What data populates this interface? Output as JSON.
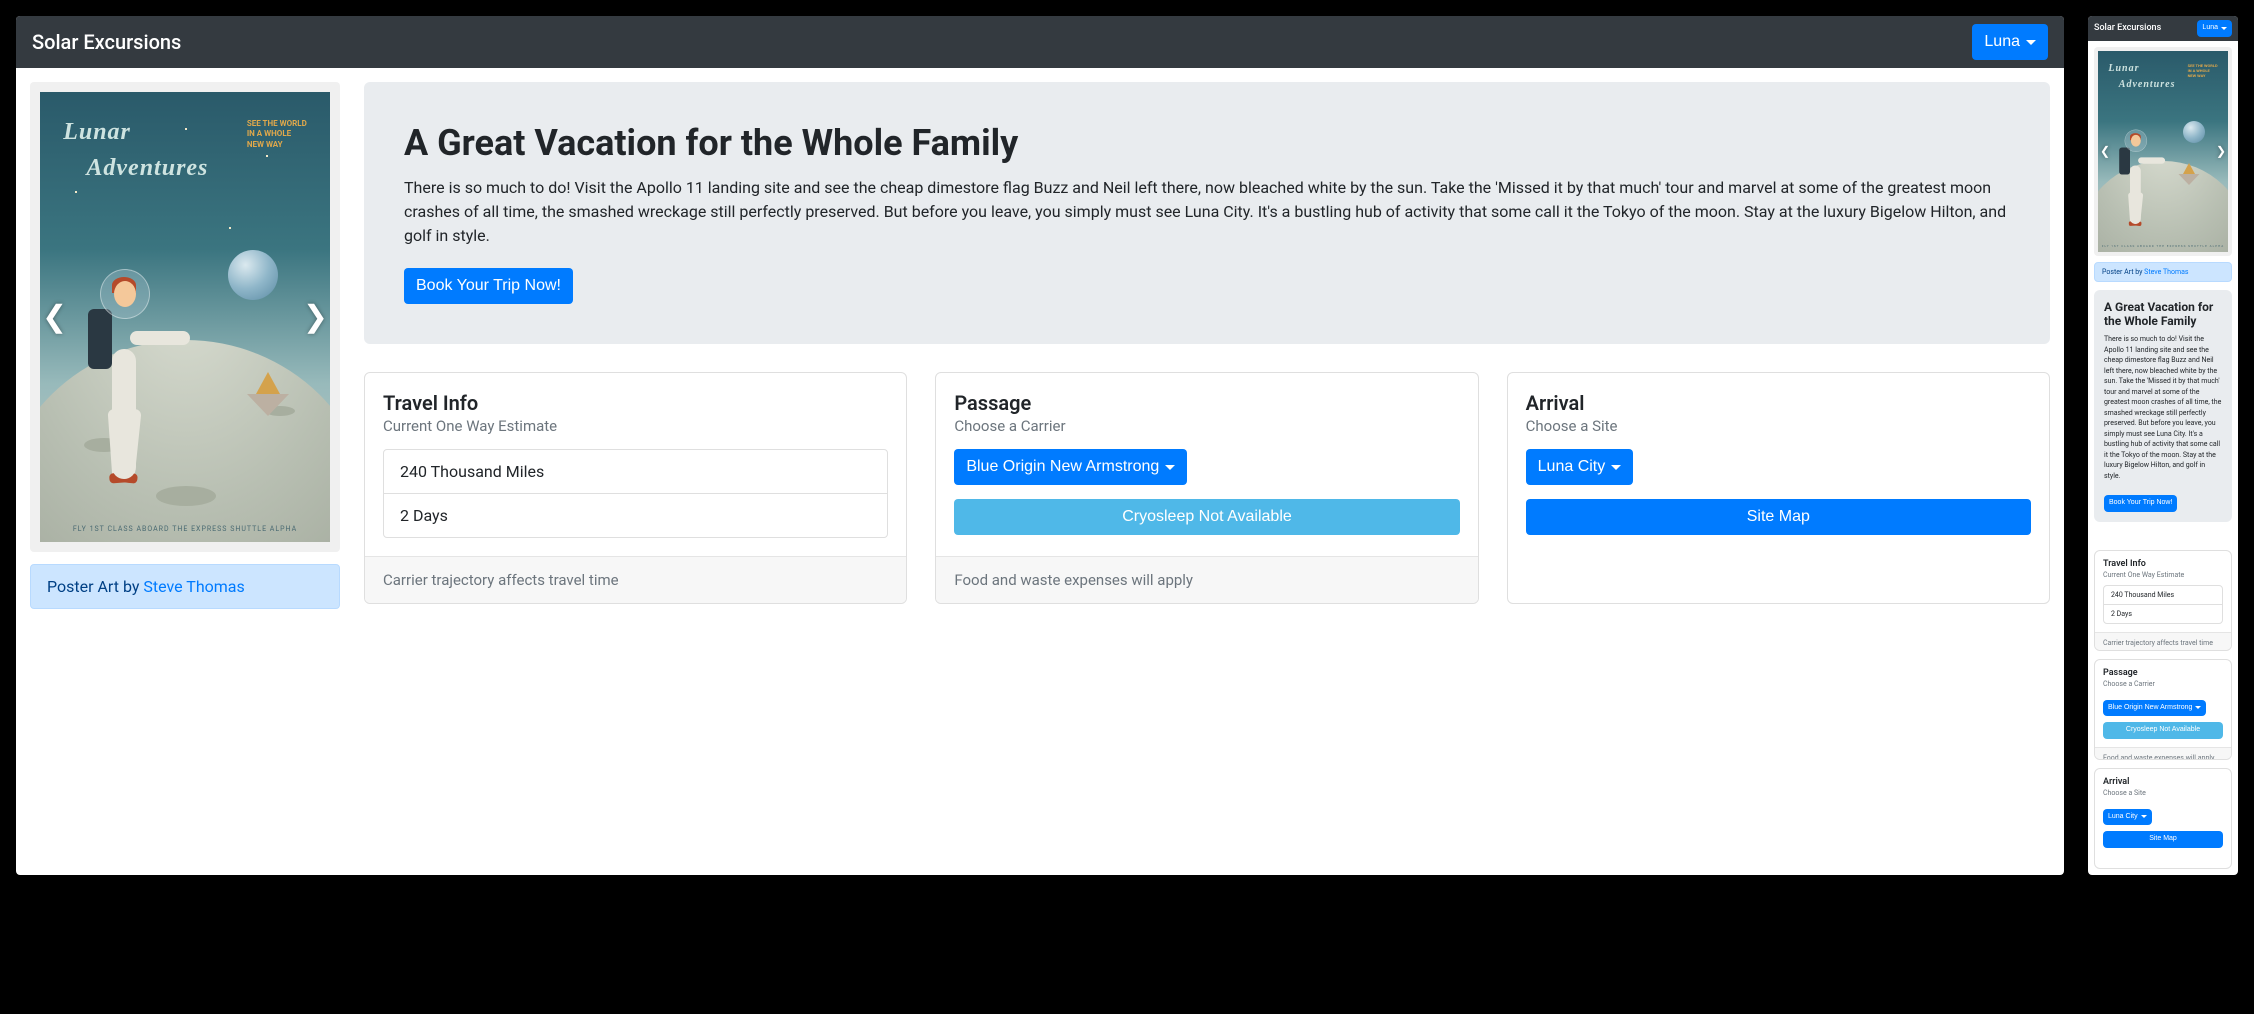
{
  "navbar": {
    "brand": "Solar Excursions",
    "destination_label": "Luna"
  },
  "poster": {
    "title_line1": "Lunar",
    "title_line2": "Adventures",
    "tagline": "SEE THE WORLD IN A WHOLE NEW WAY",
    "footer": "FLY 1ST CLASS ABOARD THE EXPRESS SHUTTLE ALPHA",
    "caption_prefix": "Poster Art by ",
    "caption_artist": "Steve Thomas"
  },
  "jumbotron": {
    "heading": "A Great Vacation for the Whole Family",
    "body": "There is so much to do! Visit the Apollo 11 landing site and see the cheap dimestore flag Buzz and Neil left there, now bleached white by the sun. Take the 'Missed it by that much' tour and marvel at some of the greatest moon crashes of all time, the smashed wreckage still perfectly preserved. But before you leave, you simply must see Luna City. It's a bustling hub of activity that some call it the Tokyo of the moon. Stay at the luxury Bigelow Hilton, and golf in style.",
    "cta": "Book Your Trip Now!"
  },
  "cards": {
    "travel": {
      "title": "Travel Info",
      "subtitle": "Current One Way Estimate",
      "distance": "240 Thousand Miles",
      "duration": "2 Days",
      "footer": "Carrier trajectory affects travel time"
    },
    "passage": {
      "title": "Passage",
      "subtitle": "Choose a Carrier",
      "carrier": "Blue Origin New Armstrong",
      "cryo": "Cryosleep Not Available",
      "footer": "Food and waste expenses will apply"
    },
    "arrival": {
      "title": "Arrival",
      "subtitle": "Choose a Site",
      "site": "Luna City",
      "map": "Site Map"
    }
  }
}
